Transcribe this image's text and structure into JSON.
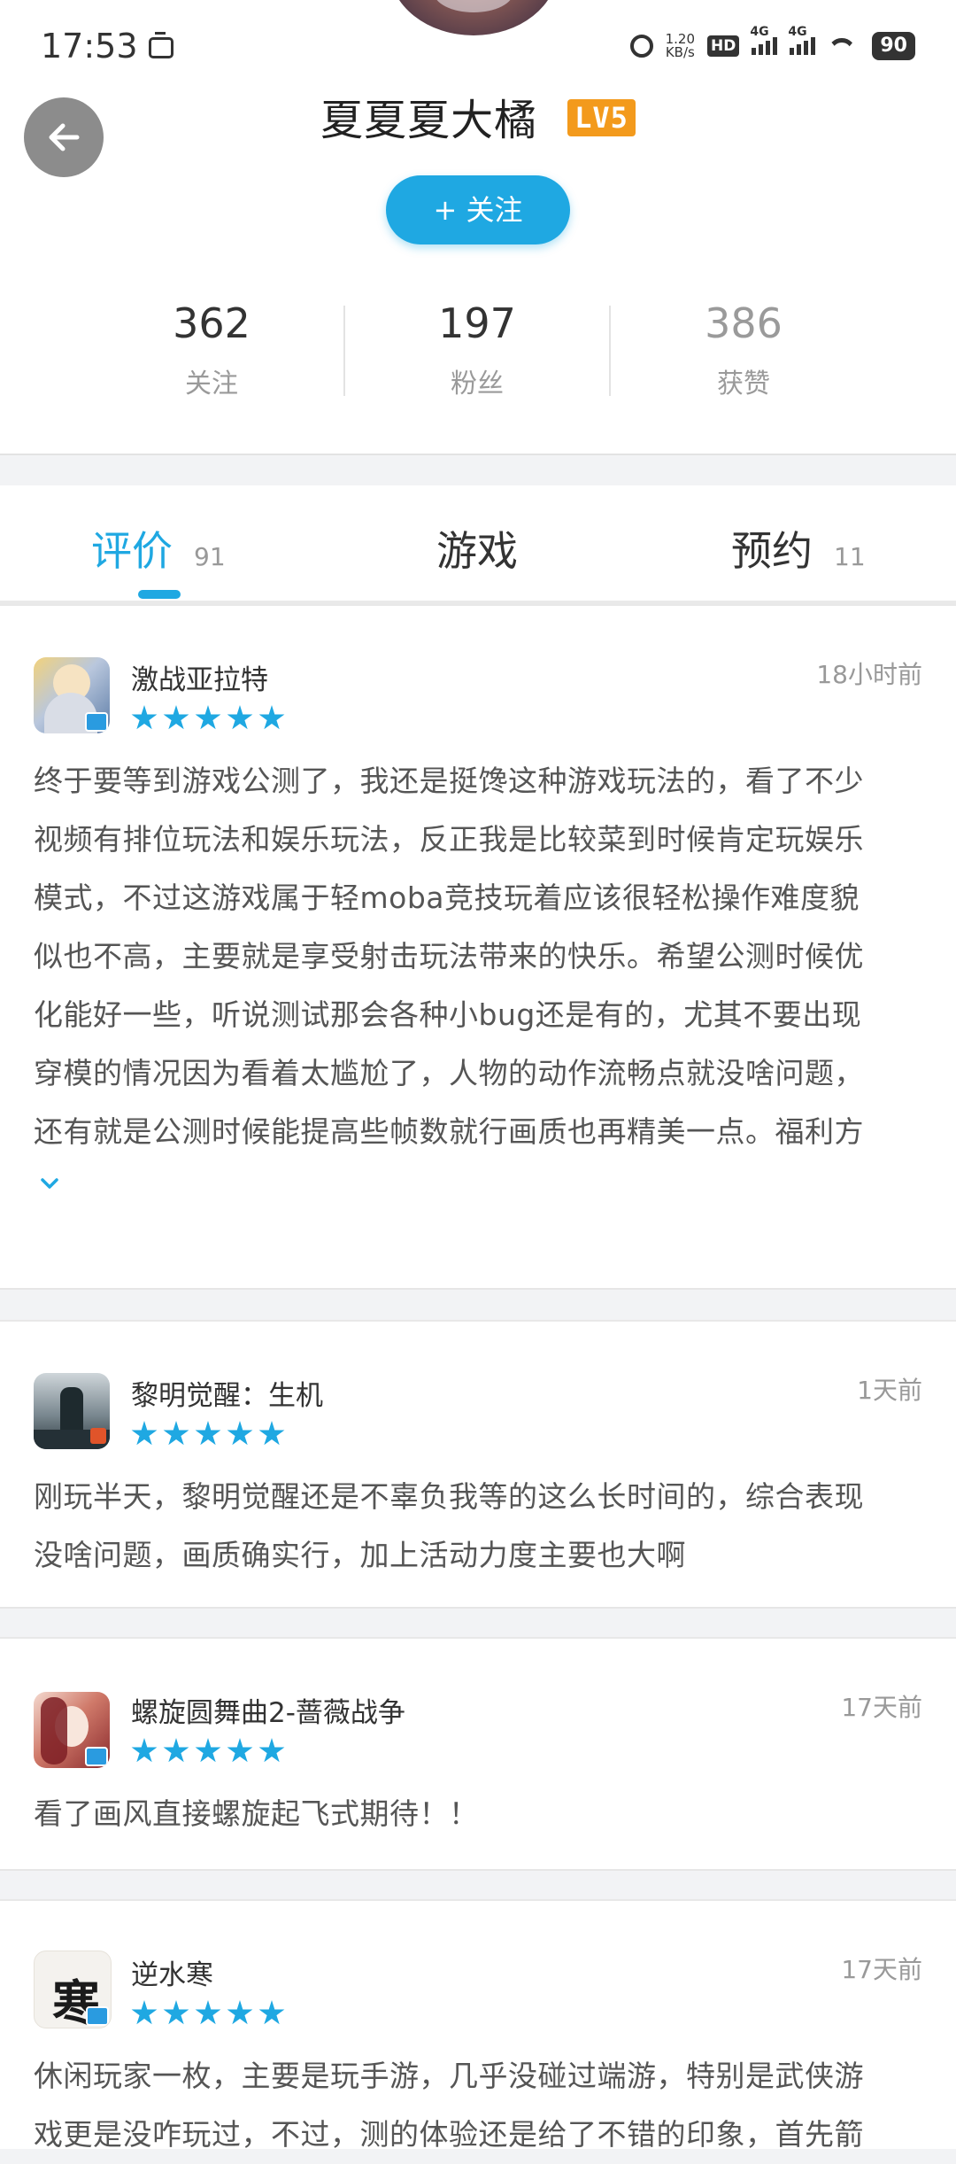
{
  "status_bar": {
    "time": "17:53",
    "speed_value": "1.20",
    "speed_unit": "KB/s",
    "hd_label": "HD",
    "net1": "4G",
    "net2": "4G",
    "battery": "90"
  },
  "profile": {
    "username": "夏夏夏大橘",
    "level_badge": "LV5",
    "follow_button": "+ 关注",
    "stats": [
      {
        "value": "362",
        "label": "关注"
      },
      {
        "value": "197",
        "label": "粉丝"
      },
      {
        "value": "386",
        "label": "获赞"
      }
    ]
  },
  "tabs": [
    {
      "label": "评价",
      "count": "91",
      "active": true
    },
    {
      "label": "游戏",
      "count": "",
      "active": false
    },
    {
      "label": "预约",
      "count": "11",
      "active": false
    }
  ],
  "reviews": [
    {
      "game": "激战亚拉特",
      "time": "18小时前",
      "rating": 5,
      "lines": [
        "终于要等到游戏公测了，我还是挺馋这种游戏玩法的，看了不少",
        "视频有排位玩法和娱乐玩法，反正我是比较菜到时候肯定玩娱乐",
        "模式，不过这游戏属于轻moba竞技玩着应该很轻松操作难度貌",
        "似也不高，主要就是享受射击玩法带来的快乐。希望公测时候优",
        "化能好一些，听说测试那会各种小bug还是有的，尤其不要出现",
        "穿模的情况因为看着太尴尬了，人物的动作流畅点就没啥问题，",
        "还有就是公测时候能提高些帧数就行画质也再精美一点。福利方"
      ]
    },
    {
      "game": "黎明觉醒：生机",
      "time": "1天前",
      "rating": 5,
      "lines": [
        "刚玩半天，黎明觉醒还是不辜负我等的这么长时间的，综合表现",
        "没啥问题，画质确实行，加上活动力度主要也大啊"
      ]
    },
    {
      "game": "螺旋圆舞曲2-蔷薇战争",
      "time": "17天前",
      "rating": 5,
      "lines": [
        "看了画风直接螺旋起飞式期待！！"
      ]
    },
    {
      "game": "逆水寒",
      "time": "17天前",
      "rating": 5,
      "lines": [
        "休闲玩家一枚，主要是玩手游，几乎没碰过端游，特别是武侠游",
        "戏更是没咋玩过，不过，测的体验还是给了不错的印象，首先箭"
      ]
    }
  ]
}
